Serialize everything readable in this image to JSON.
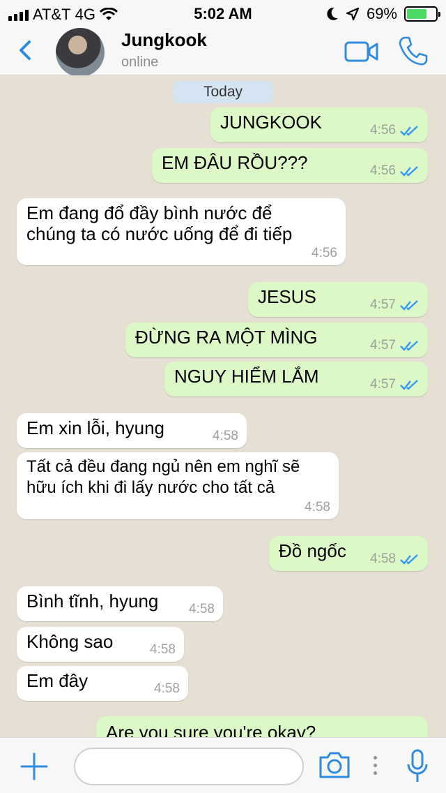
{
  "status_bar": {
    "carrier": "AT&T",
    "network": "4G",
    "time": "5:02 AM",
    "battery": "69%",
    "battery_level": 0.69
  },
  "header": {
    "name": "Jungkook",
    "status": "online"
  },
  "chat": {
    "day": "Today",
    "messages": [
      {
        "dir": "out",
        "text": "JUNGKOOK",
        "time": "4:56"
      },
      {
        "dir": "out",
        "text": "EM ĐÂU RỒU???",
        "time": "4:56"
      },
      {
        "dir": "in",
        "text": "Em đang đổ đầy bình nước để\nchúng ta có nước uống để đi tiếp",
        "time": "4:56"
      },
      {
        "dir": "out",
        "text": "JESUS",
        "time": "4:57"
      },
      {
        "dir": "out",
        "text": "ĐỪNG RA MỘT MÌNG",
        "time": "4:57"
      },
      {
        "dir": "out",
        "text": "NGUY HIỂM LẮM",
        "time": "4:57"
      },
      {
        "dir": "in",
        "text": "Em xin lỗi, hyung",
        "time": "4:58"
      },
      {
        "dir": "in",
        "text": "Tất cả đều đang ngủ nên em nghĩ sẽ\nhữu ích khi đi lấy nước cho tất cả",
        "time": "4:58"
      },
      {
        "dir": "out",
        "text": "Đồ ngốc",
        "time": "4:58"
      },
      {
        "dir": "in",
        "text": "Bình tĩnh, hyung",
        "time": "4:58"
      },
      {
        "dir": "in",
        "text": "Không sao",
        "time": "4:58"
      },
      {
        "dir": "in",
        "text": "Em đây",
        "time": "4:58"
      },
      {
        "dir": "out",
        "text": "Are you sure you're okay?",
        "time": ""
      }
    ]
  },
  "input": {
    "placeholder": ""
  },
  "colors": {
    "accent": "#2f8be0",
    "outgoing_bubble": "#dcf8c6",
    "incoming_bubble": "#ffffff",
    "chat_background": "#e6dfd4",
    "read_ticks": "#3497f9"
  },
  "icons": [
    "back-chevron-icon",
    "video-camera-icon",
    "phone-icon",
    "plus-icon",
    "camera-icon",
    "more-dots-icon",
    "microphone-icon",
    "wifi-icon",
    "moon-icon",
    "location-arrow-icon",
    "battery-icon",
    "signal-icon",
    "double-check-icon"
  ]
}
